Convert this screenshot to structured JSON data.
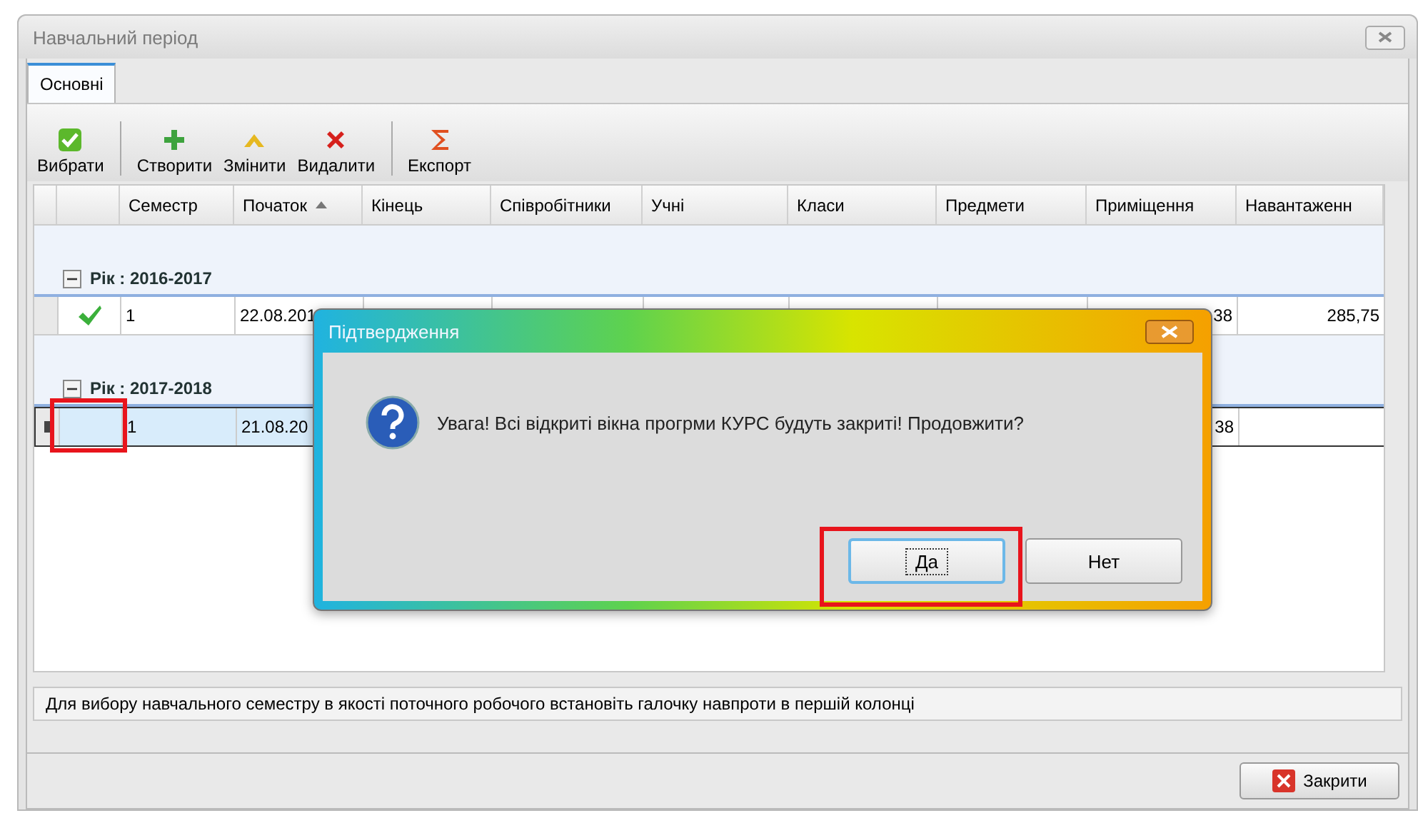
{
  "window": {
    "title": "Навчальний період"
  },
  "tabs": [
    {
      "label": "Основні",
      "selected": true
    }
  ],
  "toolbar": [
    {
      "kind": "select",
      "label": "Вибрати"
    },
    {
      "kind": "separator"
    },
    {
      "kind": "create",
      "label": "Створити"
    },
    {
      "kind": "edit",
      "label": "Змінити"
    },
    {
      "kind": "delete",
      "label": "Видалити"
    },
    {
      "kind": "separator"
    },
    {
      "kind": "export",
      "label": "Експорт"
    }
  ],
  "table": {
    "columns": [
      {
        "label": "Семестр",
        "sorted": false
      },
      {
        "label": "Початок",
        "sorted": true
      },
      {
        "label": "Кінець",
        "sorted": false
      },
      {
        "label": "Співробітники",
        "sorted": false
      },
      {
        "label": "Учні",
        "sorted": false
      },
      {
        "label": "Класи",
        "sorted": false
      },
      {
        "label": "Предмети",
        "sorted": false
      },
      {
        "label": "Приміщення",
        "sorted": false
      },
      {
        "label": "Навантаженн",
        "sorted": false
      }
    ],
    "groups": [
      {
        "label": "Рік : 2016-2017",
        "expanded": true,
        "rows": [
          {
            "checked": true,
            "current": false,
            "highlighted": false,
            "cells": [
              "1",
              "22.08.201",
              null,
              null,
              null,
              null,
              null,
              "38",
              "285,75"
            ]
          }
        ]
      },
      {
        "label": "Рік : 2017-2018",
        "expanded": true,
        "rows": [
          {
            "checked": false,
            "current": true,
            "highlighted": true,
            "cells": [
              "1",
              "21.08.20",
              null,
              null,
              null,
              null,
              null,
              "38",
              ""
            ]
          }
        ]
      }
    ]
  },
  "hint": "Для вибору навчального семестру в якості поточного робочого встановіть галочку навпроти в першій колонці",
  "close_button": "Закрити",
  "dialog": {
    "title": "Підтвердження",
    "message": "Увага! Всі відкриті вікна прогрми КУРС будуть закриті! Продовжити?",
    "buttons": [
      {
        "label": "Да",
        "default": true,
        "highlighted": true
      },
      {
        "label": "Нет",
        "default": false,
        "highlighted": false
      }
    ]
  }
}
